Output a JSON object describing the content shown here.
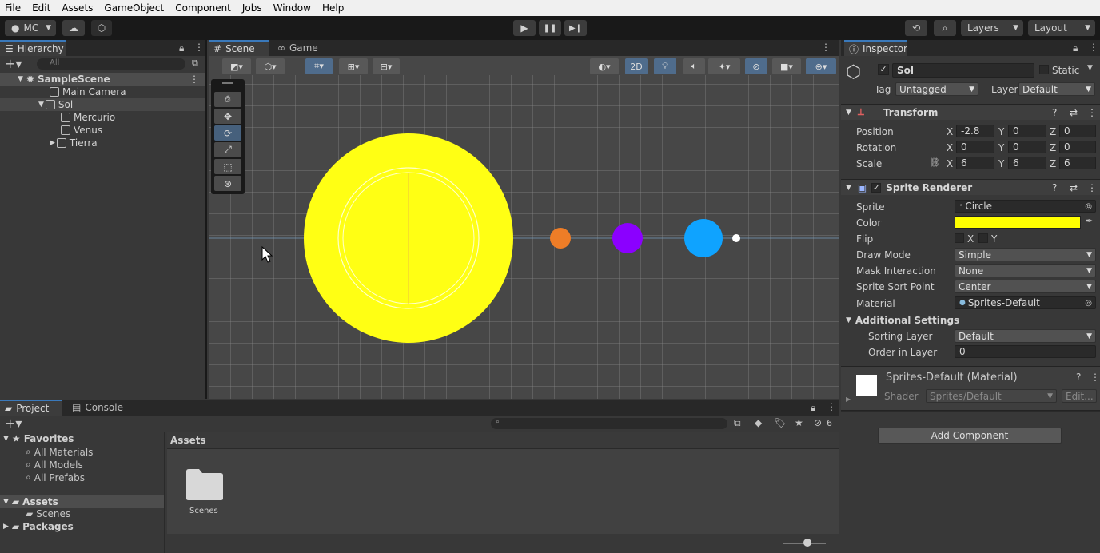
{
  "menu": [
    "File",
    "Edit",
    "Assets",
    "GameObject",
    "Component",
    "Jobs",
    "Window",
    "Help"
  ],
  "toolbar": {
    "account": "MC",
    "layers": "Layers",
    "layout": "Layout",
    "play": "▶",
    "pause": "❚❚",
    "step": "▶❙"
  },
  "hierarchy": {
    "tab": "Hierarchy",
    "search_placeholder": "All",
    "scene": "SampleScene",
    "items": [
      {
        "label": "Main Camera"
      },
      {
        "label": "Sol"
      },
      {
        "label": "Mercurio"
      },
      {
        "label": "Venus"
      },
      {
        "label": "Tierra"
      }
    ]
  },
  "scene": {
    "tabs": [
      "Scene",
      "Game"
    ],
    "mode2d": "2D",
    "planets": [
      {
        "name": "Sol",
        "color": "#ffff14"
      },
      {
        "name": "Mercurio",
        "color": "#ee7d27"
      },
      {
        "name": "Venus",
        "color": "#8b00ff"
      },
      {
        "name": "Tierra",
        "color": "#0fa3ff"
      },
      {
        "name": "Luna",
        "color": "#ffffff"
      }
    ]
  },
  "inspector": {
    "tab": "Inspector",
    "object_name": "Sol",
    "static_label": "Static",
    "tag_label": "Tag",
    "tag_value": "Untagged",
    "layer_label": "Layer",
    "layer_value": "Default",
    "transform": {
      "title": "Transform",
      "position_label": "Position",
      "rotation_label": "Rotation",
      "scale_label": "Scale",
      "position": {
        "x": "-2.8",
        "y": "0",
        "z": "0"
      },
      "rotation": {
        "x": "0",
        "y": "0",
        "z": "0"
      },
      "scale": {
        "x": "6",
        "y": "6",
        "z": "6"
      }
    },
    "sprite_renderer": {
      "title": "Sprite Renderer",
      "sprite_label": "Sprite",
      "sprite_value": "Circle",
      "color_label": "Color",
      "color_value": "#ffff00",
      "flip_label": "Flip",
      "flip_x": "X",
      "flip_y": "Y",
      "draw_mode_label": "Draw Mode",
      "draw_mode_value": "Simple",
      "mask_label": "Mask Interaction",
      "mask_value": "None",
      "sort_point_label": "Sprite Sort Point",
      "sort_point_value": "Center",
      "material_label": "Material",
      "material_value": "Sprites-Default",
      "additional": "Additional Settings",
      "sorting_layer_label": "Sorting Layer",
      "sorting_layer_value": "Default",
      "order_label": "Order in Layer",
      "order_value": "0"
    },
    "material": {
      "title": "Sprites-Default (Material)",
      "shader_label": "Shader",
      "shader_value": "Sprites/Default",
      "edit": "Edit..."
    },
    "add_component": "Add Component"
  },
  "project": {
    "tabs": [
      "Project",
      "Console"
    ],
    "hidden_count": "6",
    "favorites": "Favorites",
    "fav_items": [
      "All Materials",
      "All Models",
      "All Prefabs"
    ],
    "assets": "Assets",
    "asset_children": [
      "Scenes"
    ],
    "packages": "Packages",
    "breadcrumb": "Assets",
    "grid_items": [
      "Scenes"
    ]
  }
}
